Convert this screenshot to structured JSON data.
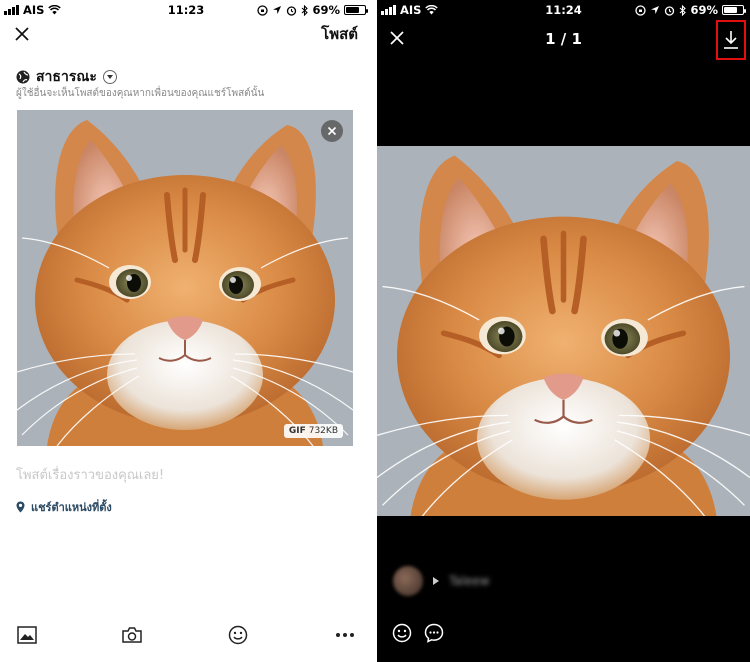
{
  "left_screen": {
    "status": {
      "carrier": "AIS",
      "time": "11:23",
      "battery": "69%"
    },
    "header": {
      "post_label": "โพสต์"
    },
    "privacy": {
      "label": "สาธารณะ",
      "hint": "ผู้ใช้อื่นจะเห็นโพสต์ของคุณหากเพื่อนของคุณแชร์โพสต์นั้น"
    },
    "attachment": {
      "type_label": "GIF",
      "size": "732KB"
    },
    "compose_placeholder": "โพสต์เรื่องราวของคุณเลย!",
    "location_label": "แชร์ตำแหน่งที่ตั้ง",
    "toolbar": [
      "image-icon",
      "camera-icon",
      "sticker-icon",
      "more-icon"
    ]
  },
  "right_screen": {
    "status": {
      "carrier": "AIS",
      "time": "11:24",
      "battery": "69%"
    },
    "counter": "1 / 1",
    "author_name": "Taleew",
    "highlight_color": "#e01010",
    "toolbar": [
      "sticker-icon",
      "comment-icon"
    ]
  }
}
